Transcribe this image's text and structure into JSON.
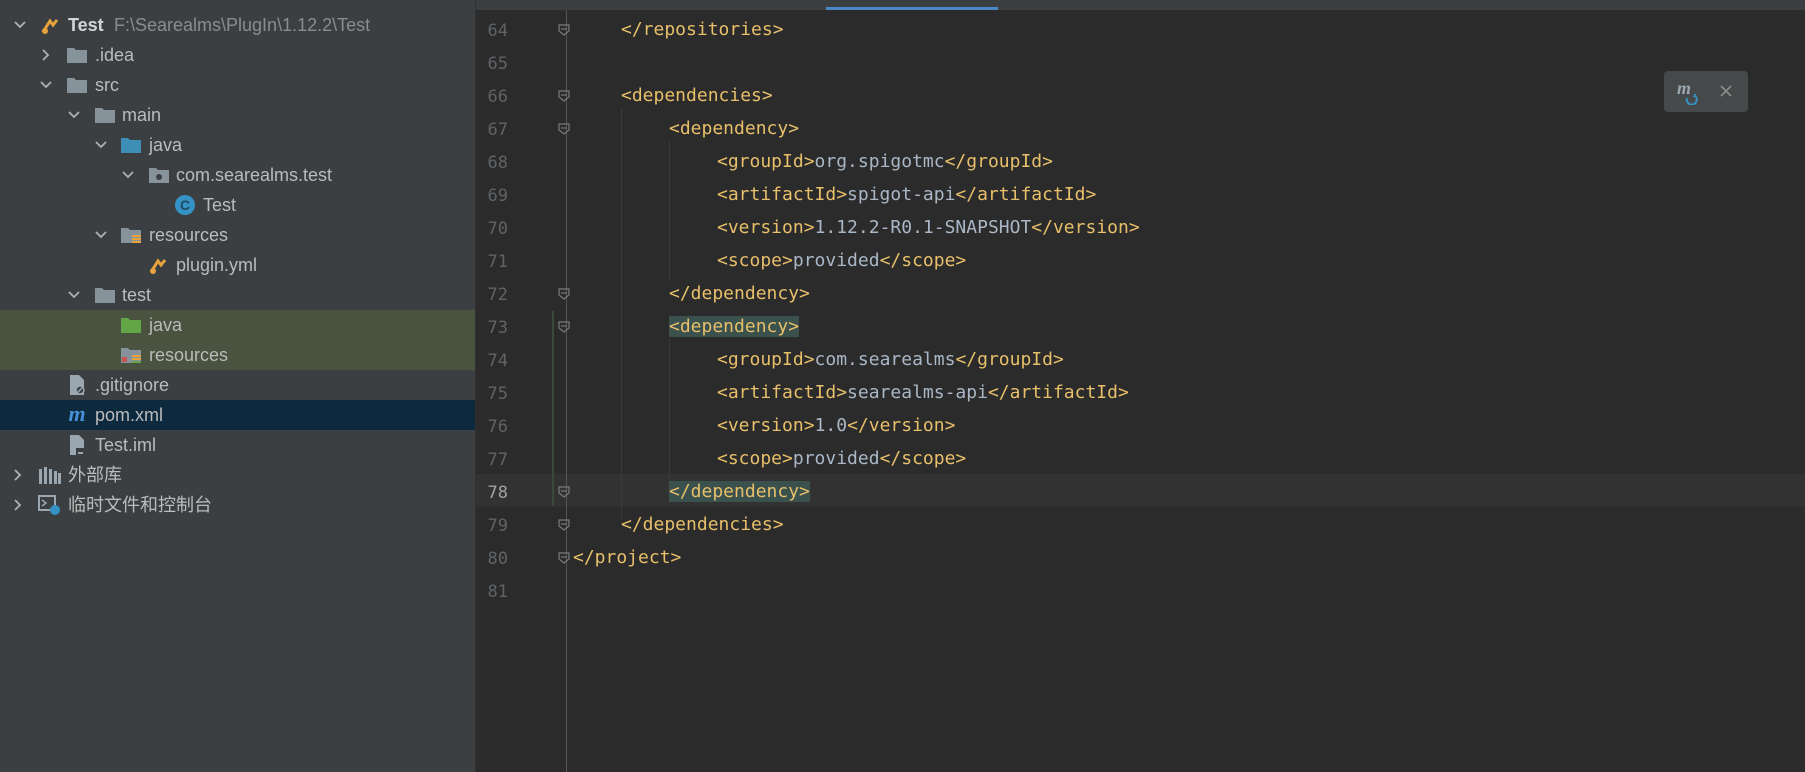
{
  "project_tree": {
    "root": {
      "name": "Test",
      "path": "F:\\Searealms\\PlugIn\\1.12.2\\Test"
    },
    "items": [
      {
        "label": ".idea"
      },
      {
        "label": "src"
      },
      {
        "label": "main"
      },
      {
        "label": "java"
      },
      {
        "label": "com.searealms.test"
      },
      {
        "label": "Test"
      },
      {
        "label": "resources"
      },
      {
        "label": "plugin.yml"
      },
      {
        "label": "test"
      },
      {
        "label": "java"
      },
      {
        "label": "resources"
      },
      {
        "label": ".gitignore"
      },
      {
        "label": "pom.xml"
      },
      {
        "label": "Test.iml"
      },
      {
        "label": "外部库"
      },
      {
        "label": "临时文件和控制台"
      }
    ]
  },
  "editor": {
    "line_numbers": [
      "64",
      "65",
      "66",
      "67",
      "68",
      "69",
      "70",
      "71",
      "72",
      "73",
      "74",
      "75",
      "76",
      "77",
      "78",
      "79",
      "80",
      "81"
    ],
    "lines": [
      {
        "open": "</repositories>",
        "text": "",
        "close": ""
      },
      {
        "open": "",
        "text": "",
        "close": ""
      },
      {
        "open": "<dependencies>",
        "text": "",
        "close": ""
      },
      {
        "open": "<dependency>",
        "text": "",
        "close": ""
      },
      {
        "open": "<groupId>",
        "text": "org.spigotmc",
        "close": "</groupId>"
      },
      {
        "open": "<artifactId>",
        "text": "spigot-api",
        "close": "</artifactId>"
      },
      {
        "open": "<version>",
        "text": "1.12.2-R0.1-SNAPSHOT",
        "close": "</version>"
      },
      {
        "open": "<scope>",
        "text": "provided",
        "close": "</scope>"
      },
      {
        "open": "</dependency>",
        "text": "",
        "close": ""
      },
      {
        "open": "<dependency>",
        "text": "",
        "close": ""
      },
      {
        "open": "<groupId>",
        "text": "com.searealms",
        "close": "</groupId>"
      },
      {
        "open": "<artifactId>",
        "text": "searealms-api",
        "close": "</artifactId>"
      },
      {
        "open": "<version>",
        "text": "1.0",
        "close": "</version>"
      },
      {
        "open": "<scope>",
        "text": "provided",
        "close": "</scope>"
      },
      {
        "open": "</dependency>",
        "text": "",
        "close": ""
      },
      {
        "open": "</dependencies>",
        "text": "",
        "close": ""
      },
      {
        "open": "</project>",
        "text": "",
        "close": ""
      },
      {
        "open": "",
        "text": "",
        "close": ""
      }
    ],
    "current_line": "78"
  },
  "icons": {
    "maven_reload": "maven-reload-icon",
    "close": "close-icon"
  },
  "colors": {
    "tag": "#e8bf6a",
    "text": "#a9b7c6",
    "selection": "#0d293e",
    "accent": "#4a88c7"
  }
}
